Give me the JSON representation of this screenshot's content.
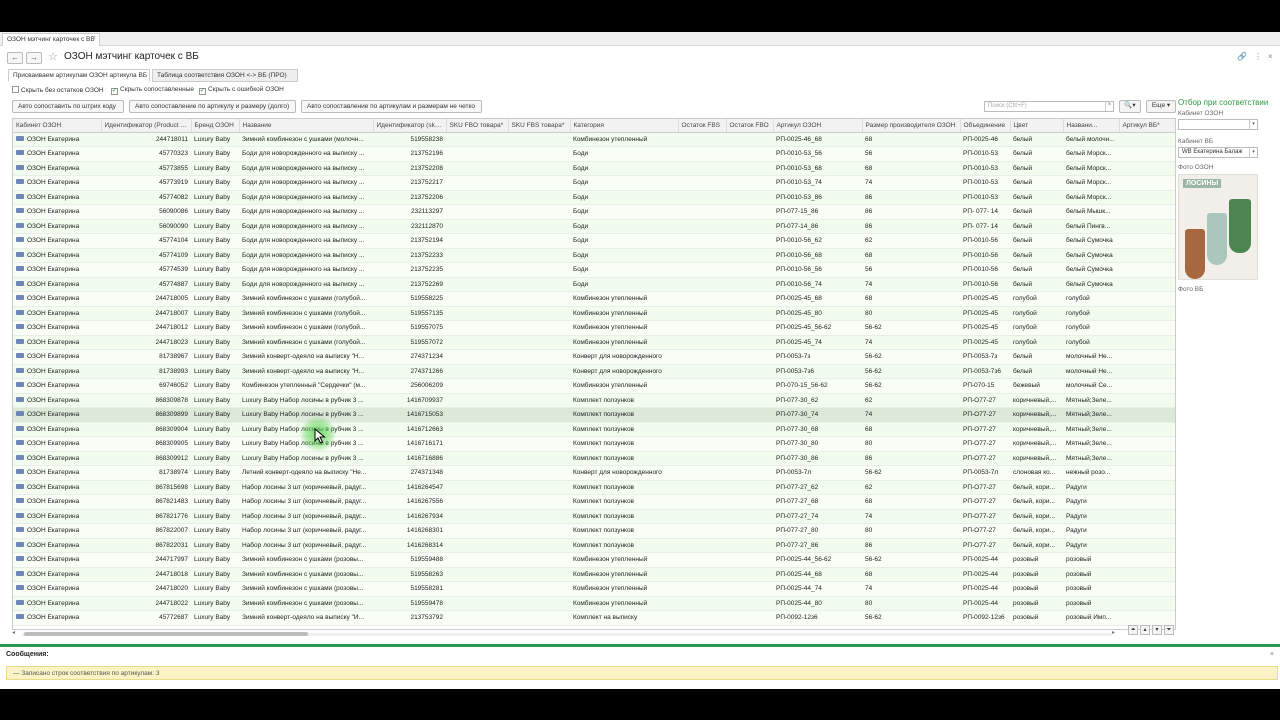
{
  "doc_tab": "ОЗОН мэтчинг карточек с ВБ",
  "title": "ОЗОН мэтчинг карточек с ВБ",
  "form_tabs": [
    "Присваиваем артикулам ОЗОН артикула ВБ",
    "Таблица соответствия ОЗОН <-> ВБ (ПРО)"
  ],
  "checkboxes": [
    {
      "label": "Скрыть без остатков ОЗОН",
      "checked": false
    },
    {
      "label": "Скрыть сопоставленные",
      "checked": true
    },
    {
      "label": "Скрыть с ошибкой ОЗОН",
      "checked": true
    }
  ],
  "buttons": [
    "Авто сопоставить по штрих коду",
    "Авто сопоставление по артикулу и размеру (долго)",
    "Авто сопоставление по артикулам и размерам не четко"
  ],
  "search": {
    "placeholder": "Поиск (Ctrl+F)",
    "more_label": "Еще"
  },
  "columns": [
    "Кабинет ОЗОН",
    "Идентификатор (Product id)",
    "Бренд ОЗОН",
    "Название",
    "Идентификатор (sku)*",
    "SKU FBO товара*",
    "SKU FBS товара*",
    "Категория",
    "Остаток FBS",
    "Остаток FBO",
    "Артикул ОЗОН",
    "Размер производителя ОЗОН",
    "Объединение",
    "Цвет",
    "Названи...",
    "Артикул ВБ*"
  ],
  "rows": [
    [
      "ОЗОН Екатерина",
      "244718011",
      "Luxury Baby",
      "Зимний комбинезон с ушками (молочн...",
      "519558238",
      "",
      "",
      "Комбинезон утепленный",
      "",
      "",
      "РП-0025-46_68",
      "68",
      "РП-0025-46",
      "белый",
      "белый молочн...",
      ""
    ],
    [
      "ОЗОН Екатерина",
      "45770323",
      "Luxury Baby",
      "Боди для новорожденного на выписку ...",
      "213752196",
      "",
      "",
      "Боди",
      "",
      "",
      "РП-0010-53_56",
      "56",
      "РП-0010-53",
      "белый",
      "белый Морск...",
      ""
    ],
    [
      "ОЗОН Екатерина",
      "45773855",
      "Luxury Baby",
      "Боди для новорожденного на выписку ...",
      "213752208",
      "",
      "",
      "Боди",
      "",
      "",
      "РП-0010-53_68",
      "68",
      "РП-0010-53",
      "белый",
      "белый Морск...",
      ""
    ],
    [
      "ОЗОН Екатерина",
      "45773919",
      "Luxury Baby",
      "Боди для новорожденного на выписку ...",
      "213752217",
      "",
      "",
      "Боди",
      "",
      "",
      "РП-0010-53_74",
      "74",
      "РП-0010-53",
      "белый",
      "белый Морск...",
      ""
    ],
    [
      "ОЗОН Екатерина",
      "45774082",
      "Luxury Baby",
      "Боди для новорожденного на выписку ...",
      "213752206",
      "",
      "",
      "Боди",
      "",
      "",
      "РП-0010-53_86",
      "86",
      "РП-0010-53",
      "белый",
      "белый Морск...",
      ""
    ],
    [
      "ОЗОН Екатерина",
      "56090086",
      "Luxury Baby",
      "Боди для новорожденного на выписку ...",
      "232113297",
      "",
      "",
      "Боди",
      "",
      "",
      "РП-077-15_86",
      "86",
      "РП- 077- 14",
      "белый",
      "белый Мышк...",
      ""
    ],
    [
      "ОЗОН Екатерина",
      "56090090",
      "Luxury Baby",
      "Боди для новорожденного на выписку ...",
      "232112870",
      "",
      "",
      "Боди",
      "",
      "",
      "РП-077-14_86",
      "86",
      "РП- 077- 14",
      "белый",
      "белый Пингв...",
      ""
    ],
    [
      "ОЗОН Екатерина",
      "45774104",
      "Luxury Baby",
      "Боди для новорожденного на выписку ...",
      "213752194",
      "",
      "",
      "Боди",
      "",
      "",
      "РП-0010-56_62",
      "62",
      "РП-0010-56",
      "белый",
      "белый Сумочка",
      ""
    ],
    [
      "ОЗОН Екатерина",
      "45774109",
      "Luxury Baby",
      "Боди для новорожденного на выписку ...",
      "213752233",
      "",
      "",
      "Боди",
      "",
      "",
      "РП-0010-56_68",
      "68",
      "РП-0010-56",
      "белый",
      "белый Сумочка",
      ""
    ],
    [
      "ОЗОН Екатерина",
      "45774539",
      "Luxury Baby",
      "Боди для новорожденного на выписку ...",
      "213752235",
      "",
      "",
      "Боди",
      "",
      "",
      "РП-0010-56_56",
      "56",
      "РП-0010-56",
      "белый",
      "белый Сумочка",
      ""
    ],
    [
      "ОЗОН Екатерина",
      "45774887",
      "Luxury Baby",
      "Боди для новорожденного на выписку ...",
      "213752269",
      "",
      "",
      "Боди",
      "",
      "",
      "РП-0010-56_74",
      "74",
      "РП-0010-56",
      "белый",
      "белый Сумочка",
      ""
    ],
    [
      "ОЗОН Екатерина",
      "244718005",
      "Luxury Baby",
      "Зимний комбинезон с ушками (голубой...",
      "519558225",
      "",
      "",
      "Комбинезон утепленный",
      "",
      "",
      "РП-0025-45_68",
      "68",
      "РП-0025-45",
      "голубой",
      "голубой",
      ""
    ],
    [
      "ОЗОН Екатерина",
      "244718007",
      "Luxury Baby",
      "Зимний комбинезон с ушками (голубой...",
      "519557135",
      "",
      "",
      "Комбинезон утепленный",
      "",
      "",
      "РП-0025-45_80",
      "80",
      "РП-0025-45",
      "голубой",
      "голубой",
      ""
    ],
    [
      "ОЗОН Екатерина",
      "244718012",
      "Luxury Baby",
      "Зимний комбинезон с ушками (голубой...",
      "519557075",
      "",
      "",
      "Комбинезон утепленный",
      "",
      "",
      "РП-0025-45_56-62",
      "56-62",
      "РП-0025-45",
      "голубой",
      "голубой",
      ""
    ],
    [
      "ОЗОН Екатерина",
      "244718023",
      "Luxury Baby",
      "Зимний комбинезон с ушками (голубой...",
      "519557072",
      "",
      "",
      "Комбинезон утепленный",
      "",
      "",
      "РП-0025-45_74",
      "74",
      "РП-0025-45",
      "голубой",
      "голубой",
      ""
    ],
    [
      "ОЗОН Екатерина",
      "81738967",
      "Luxury Baby",
      "Зимний конверт-одеяло на выписку \"Н...",
      "274371234",
      "",
      "",
      "Конверт для новорожденного",
      "",
      "",
      "РП-0053-7з",
      "56-62",
      "РП-0053-7з",
      "белый",
      "молочный Не...",
      ""
    ],
    [
      "ОЗОН Екатерина",
      "81738993",
      "Luxury Baby",
      "Зимний конверт-одеяло на выписку \"Н...",
      "274371266",
      "",
      "",
      "Конверт для новорожденного",
      "",
      "",
      "РП-0053-7з6",
      "56-62",
      "РП-0053-7з6",
      "белый",
      "молочный Не...",
      ""
    ],
    [
      "ОЗОН Екатерина",
      "69746052",
      "Luxury Baby",
      "Комбинезон утепленный \"Сердечки\" (м...",
      "256006209",
      "",
      "",
      "Комбинезон утепленный",
      "",
      "",
      "РП-070-15_56-62",
      "56-62",
      "РП-070-15",
      "бежевый",
      "молочный Се...",
      ""
    ],
    [
      "ОЗОН Екатерина",
      "868309878",
      "Luxury Baby",
      "Luxury Baby Набор лосины в рубчик 3 ...",
      "1416709937",
      "",
      "",
      "Комплект ползунков",
      "",
      "",
      "РП-077-30_62",
      "62",
      "РП-О77-27",
      "коричневый,...",
      "Мятный;Зеле...",
      ""
    ],
    [
      "ОЗОН Екатерина",
      "868309899",
      "Luxury Baby",
      "Luxury Baby Набор лосины в рубчик 3 ...",
      "1416715053",
      "",
      "",
      "Комплект ползунков",
      "",
      "",
      "РП-077-30_74",
      "74",
      "РП-О77-27",
      "коричневый,...",
      "Мятный;Зеле...",
      ""
    ],
    [
      "ОЗОН Екатерина",
      "868309904",
      "Luxury Baby",
      "Luxury Baby Набор лосины в рубчик 3 ...",
      "1416712663",
      "",
      "",
      "Комплект ползунков",
      "",
      "",
      "РП-077-30_68",
      "68",
      "РП-О77-27",
      "коричневый,...",
      "Мятный;Зеле...",
      ""
    ],
    [
      "ОЗОН Екатерина",
      "868309905",
      "Luxury Baby",
      "Luxury Baby Набор лосины в рубчик 3 ...",
      "1416716171",
      "",
      "",
      "Комплект ползунков",
      "",
      "",
      "РП-077-30_80",
      "80",
      "РП-О77-27",
      "коричневый,...",
      "Мятный;Зеле...",
      ""
    ],
    [
      "ОЗОН Екатерина",
      "868309912",
      "Luxury Baby",
      "Luxury Baby Набор лосины в рубчик 3 ...",
      "1416716886",
      "",
      "",
      "Комплект ползунков",
      "",
      "",
      "РП-077-30_86",
      "86",
      "РП-О77-27",
      "коричневый,...",
      "Мятный;Зеле...",
      ""
    ],
    [
      "ОЗОН Екатерина",
      "81738974",
      "Luxury Baby",
      "Летний конверт-одеяло на выписку \"Не...",
      "274371348",
      "",
      "",
      "Конверт для новорожденного",
      "",
      "",
      "РП-0053-7л",
      "56-62",
      "РП-0053-7л",
      "слоновая ко...",
      "нежный розо...",
      ""
    ],
    [
      "ОЗОН Екатерина",
      "867815698",
      "Luxury Baby",
      "Набор лосины 3 шт (коричневый, радуг...",
      "1416264547",
      "",
      "",
      "Комплект ползунков",
      "",
      "",
      "РП-077-27_62",
      "62",
      "РП-О77-27",
      "белый, кори...",
      "Радуги",
      ""
    ],
    [
      "ОЗОН Екатерина",
      "867821483",
      "Luxury Baby",
      "Набор лосины 3 шт (коричневый, радуг...",
      "1416267556",
      "",
      "",
      "Комплект ползунков",
      "",
      "",
      "РП-077-27_68",
      "68",
      "РП-О77-27",
      "белый, кори...",
      "Радуги",
      ""
    ],
    [
      "ОЗОН Екатерина",
      "867821776",
      "Luxury Baby",
      "Набор лосины 3 шт (коричневый, радуг...",
      "1416267934",
      "",
      "",
      "Комплект ползунков",
      "",
      "",
      "РП-077-27_74",
      "74",
      "РП-О77-27",
      "белый, кори...",
      "Радуги",
      ""
    ],
    [
      "ОЗОН Екатерина",
      "867822007",
      "Luxury Baby",
      "Набор лосины 3 шт (коричневый, радуг...",
      "1416268301",
      "",
      "",
      "Комплект ползунков",
      "",
      "",
      "РП-077-27_80",
      "80",
      "РП-О77-27",
      "белый, кори...",
      "Радуги",
      ""
    ],
    [
      "ОЗОН Екатерина",
      "867822031",
      "Luxury Baby",
      "Набор лосины 3 шт (коричневый, радуг...",
      "1416268314",
      "",
      "",
      "Комплект ползунков",
      "",
      "",
      "РП-077-27_86",
      "86",
      "РП-О77-27",
      "белый, кори...",
      "Радуги",
      ""
    ],
    [
      "ОЗОН Екатерина",
      "244717997",
      "Luxury Baby",
      "Зимний комбинезон с ушками (розовы...",
      "519559488",
      "",
      "",
      "Комбинезон утепленный",
      "",
      "",
      "РП-0025-44_56-62",
      "56-62",
      "РП-0025-44",
      "розовый",
      "розовый",
      ""
    ],
    [
      "ОЗОН Екатерина",
      "244718018",
      "Luxury Baby",
      "Зимний комбинезон с ушками (розовы...",
      "519558263",
      "",
      "",
      "Комбинезон утепленный",
      "",
      "",
      "РП-0025-44_68",
      "68",
      "РП-0025-44",
      "розовый",
      "розовый",
      ""
    ],
    [
      "ОЗОН Екатерина",
      "244718020",
      "Luxury Baby",
      "Зимний комбинезон с ушками (розовы...",
      "519558281",
      "",
      "",
      "Комбинезон утепленный",
      "",
      "",
      "РП-0025-44_74",
      "74",
      "РП-0025-44",
      "розовый",
      "розовый",
      ""
    ],
    [
      "ОЗОН Екатерина",
      "244718022",
      "Luxury Baby",
      "Зимний комбинезон с ушками (розовы...",
      "519559478",
      "",
      "",
      "Комбинезон утепленный",
      "",
      "",
      "РП-0025-44_80",
      "80",
      "РП-0025-44",
      "розовый",
      "розовый",
      ""
    ],
    [
      "ОЗОН Екатерина",
      "45772687",
      "Luxury Baby",
      "Зимний конверт-одеяло на выписку \"И...",
      "213753792",
      "",
      "",
      "Комплект на выписку",
      "",
      "",
      "РП-0092-12з6",
      "56-62",
      "РП-0092-12з6",
      "розовый",
      "розовый Имп...",
      ""
    ]
  ],
  "selected_row": 19,
  "right_panel": {
    "title": "Отбор при соответствии",
    "cab_ozon_label": "Кабинет ОЗОН",
    "cab_ozon_value": "",
    "cab_wb_label": "Кабинет ВБ",
    "cab_wb_value": "WB Екатерина Балаж",
    "photo_ozon_label": "Фото ОЗОН",
    "photo_text": "ЛОСИНЫ",
    "photo_wb_label": "Фото ВБ"
  },
  "messages": {
    "title": "Сообщения:",
    "line": "Записано строк соответствия по артикулам: 3"
  },
  "colors": {
    "accent": "#2e9a3f",
    "row_bg": "#f1fcef",
    "selected_row": "#dce9d8",
    "message_bg": "#fbf3c6"
  }
}
